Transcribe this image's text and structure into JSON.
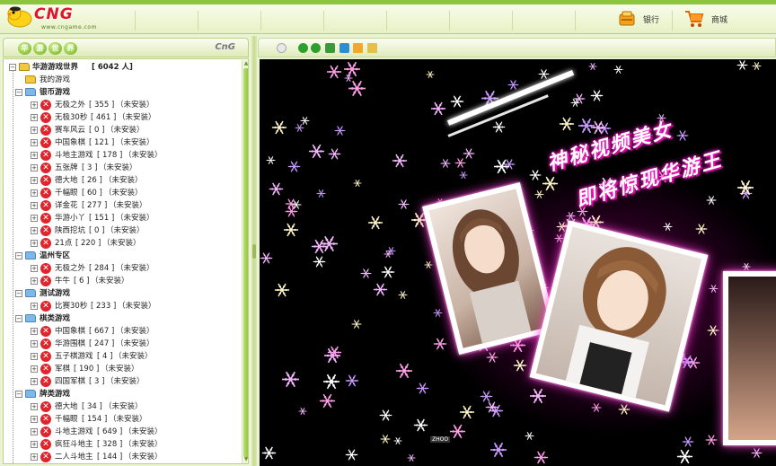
{
  "header": {
    "logo_text": "CNG",
    "logo_url": "www.cngame.com",
    "bank_label": "银行",
    "shop_label": "商城",
    "bank_icon": "bank-icon",
    "shop_icon": "shopping-cart-icon"
  },
  "sidebar": {
    "title_chars": [
      "华",
      "游",
      "世",
      "界"
    ],
    "mini_logo": "CnG",
    "root_label": "华游游戏世界",
    "root_count": "[ 6042 人]",
    "my_games": "我的游戏",
    "groups": [
      {
        "label": "银币游戏",
        "items": [
          {
            "label": "无极之外",
            "count": "[ 355 ]",
            "status": "（未安装）"
          },
          {
            "label": "无极30秒",
            "count": "[ 461 ]",
            "status": "（未安装）"
          },
          {
            "label": "赛车风云",
            "count": "[ 0 ]",
            "status": "（未安装）"
          },
          {
            "label": "中国象棋",
            "count": "[ 121 ]",
            "status": "（未安装）"
          },
          {
            "label": "斗地主游戏",
            "count": "[ 178 ]",
            "status": "（未安装）"
          },
          {
            "label": "五张牌",
            "count": "[ 3 ]",
            "status": "（未安装）"
          },
          {
            "label": "德大地",
            "count": "[ 26 ]",
            "status": "（未安装）"
          },
          {
            "label": "千幅眼",
            "count": "[ 60 ]",
            "status": "（未安装）"
          },
          {
            "label": "详金花",
            "count": "[ 277 ]",
            "status": "（未安装）"
          },
          {
            "label": "华游小丫",
            "count": "[ 151 ]",
            "status": "（未安装）"
          },
          {
            "label": "陕西挖坑",
            "count": "[ 0 ]",
            "status": "（未安装）"
          },
          {
            "label": "21点",
            "count": "[ 220 ]",
            "status": "（未安装）"
          }
        ]
      },
      {
        "label": "温州专区",
        "items": [
          {
            "label": "无极之外",
            "count": "[ 284 ]",
            "status": "（未安装）"
          },
          {
            "label": "牛牛",
            "count": "[ 6 ]",
            "status": "（未安装）"
          }
        ]
      },
      {
        "label": "测试游戏",
        "items": [
          {
            "label": "比赛30秒",
            "count": "[ 233 ]",
            "status": "（未安装）"
          }
        ]
      },
      {
        "label": "棋类游戏",
        "items": [
          {
            "label": "中国象棋",
            "count": "[ 667 ]",
            "status": "（未安装）"
          },
          {
            "label": "华游围棋",
            "count": "[ 247 ]",
            "status": "（未安装）"
          },
          {
            "label": "五子棋游戏",
            "count": "[ 4 ]",
            "status": "（未安装）"
          },
          {
            "label": "军棋",
            "count": "[ 190 ]",
            "status": "（未安装）"
          },
          {
            "label": "四国军棋",
            "count": "[ 3 ]",
            "status": "（未安装）"
          }
        ]
      },
      {
        "label": "牌类游戏",
        "items": [
          {
            "label": "德大地",
            "count": "[ 34 ]",
            "status": "（未安装）"
          },
          {
            "label": "千幅眼",
            "count": "[ 154 ]",
            "status": "（未安装）"
          },
          {
            "label": "斗地主游戏",
            "count": "[ 649 ]",
            "status": "（未安装）"
          },
          {
            "label": "疯狂斗地主",
            "count": "[ 328 ]",
            "status": "（未安装）"
          },
          {
            "label": "二人斗地主",
            "count": "[ 144 ]",
            "status": "（未安装）"
          }
        ]
      }
    ]
  },
  "content": {
    "headline_1": "神秘视频美女",
    "headline_2": "即将惊现华游王",
    "tiny_label": "ZHOO"
  },
  "colors": {
    "accent_green": "#8cc63e",
    "error_red": "#e0242c",
    "glow_pink": "#ff3cd6"
  }
}
